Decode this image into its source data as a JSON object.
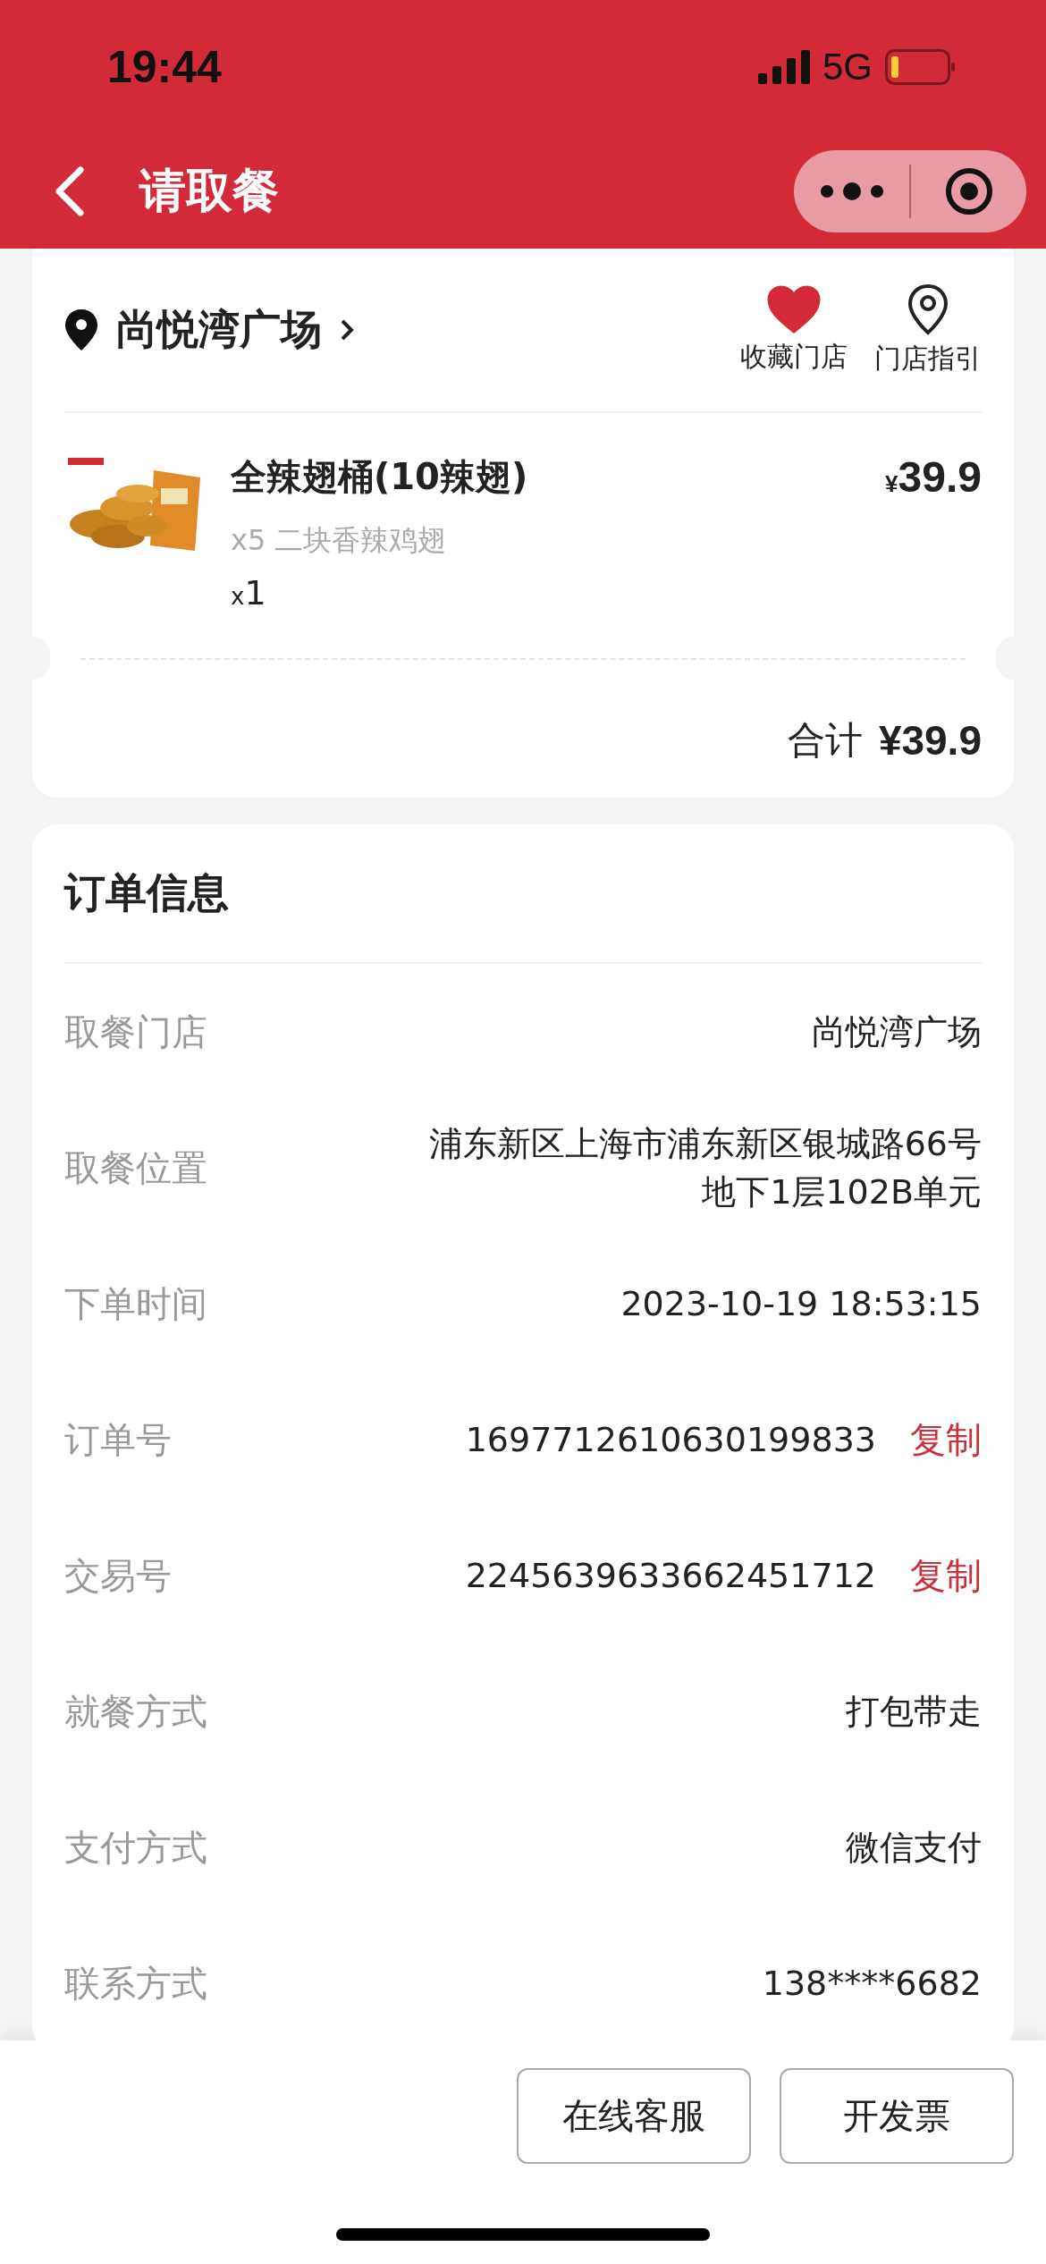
{
  "status_bar": {
    "time": "19:44",
    "network": "5G"
  },
  "nav": {
    "title": "请取餐"
  },
  "store": {
    "name": "尚悦湾广场",
    "favorite": {
      "label": "收藏门店",
      "favorited": true
    },
    "guide": {
      "label": "门店指引"
    }
  },
  "items": [
    {
      "name": "全辣翅桶(10辣翅)",
      "detail": "x5 二块香辣鸡翅",
      "quantity_prefix": "x",
      "quantity": "1",
      "currency": "¥",
      "price": "39.9"
    }
  ],
  "total": {
    "label": "合计",
    "amount": "¥39.9"
  },
  "order_info": {
    "title": "订单信息",
    "rows": [
      {
        "label": "取餐门店",
        "value": [
          "尚悦湾广场"
        ]
      },
      {
        "label": "取餐位置",
        "value": [
          "浦东新区上海市浦东新区银城路66号",
          "地下1层102B单元"
        ]
      },
      {
        "label": "下单时间",
        "value": [
          "2023-10-19 18:53:15"
        ]
      },
      {
        "label": "订单号",
        "value": [
          "1697712610630199833"
        ],
        "action": "复制"
      },
      {
        "label": "交易号",
        "value": [
          "2245639633662451712"
        ],
        "action": "复制"
      },
      {
        "label": "就餐方式",
        "value": [
          "打包带走"
        ]
      },
      {
        "label": "支付方式",
        "value": [
          "微信支付"
        ]
      },
      {
        "label": "联系方式",
        "value": [
          "138****6682"
        ]
      }
    ]
  },
  "buttons": [
    "在线客服",
    "开发票"
  ]
}
